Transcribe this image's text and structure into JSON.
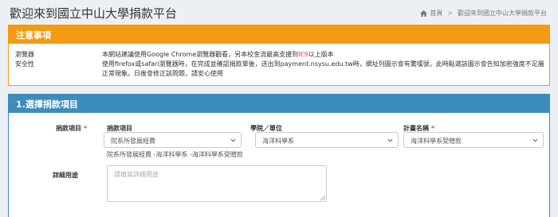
{
  "header": {
    "title": "歡迎來到國立中山大學捐款平台",
    "breadcrumb": {
      "home": "首頁",
      "separator": ">",
      "current": "歡迎來到國立中山大學捐款平台"
    }
  },
  "notice": {
    "title": "注意事項",
    "labels": [
      "瀏覽器",
      "安全性"
    ],
    "line1_prefix": "本網站建議使用Google Chrome瀏覽器觀看，另本校金流最高支援到",
    "line1_highlight": "IE9",
    "line1_suffix": "以上版本",
    "line2": "使用firefox或safari瀏覽器時，在完成並確認捐款單後，送出到payment.nsysu.edu.tw時，網址列圖示會有驚嘆號，此時點選該圖示會告知加密強度不足屬正常現象。日後會修正該問題，請安心使用"
  },
  "donate": {
    "section_title": "1.選擇捐款項目",
    "item_row_label": "捐款項目",
    "required_mark": "*",
    "columns": {
      "item": {
        "label": "捐款項目",
        "selected": "院系所發展經費"
      },
      "dept": {
        "label": "學院／單位",
        "selected": "海洋科學系"
      },
      "plan": {
        "label": "計畫名稱",
        "required_mark": "*",
        "selected": "海洋科學系受贈款"
      }
    },
    "summary": "院系所發展經費 -海洋科學系 -海洋科學系受贈款",
    "purpose_label": "詳細用途",
    "purpose_placeholder": "請填寫詳細用途",
    "purpose_value": ""
  },
  "colors": {
    "warning": "#f39c12",
    "primary": "#3c8dbc",
    "danger": "#dd4b39",
    "background": "#ecf0f5"
  },
  "icons": {
    "breadcrumb": "home-icon",
    "select": "chevron-down-icon"
  }
}
